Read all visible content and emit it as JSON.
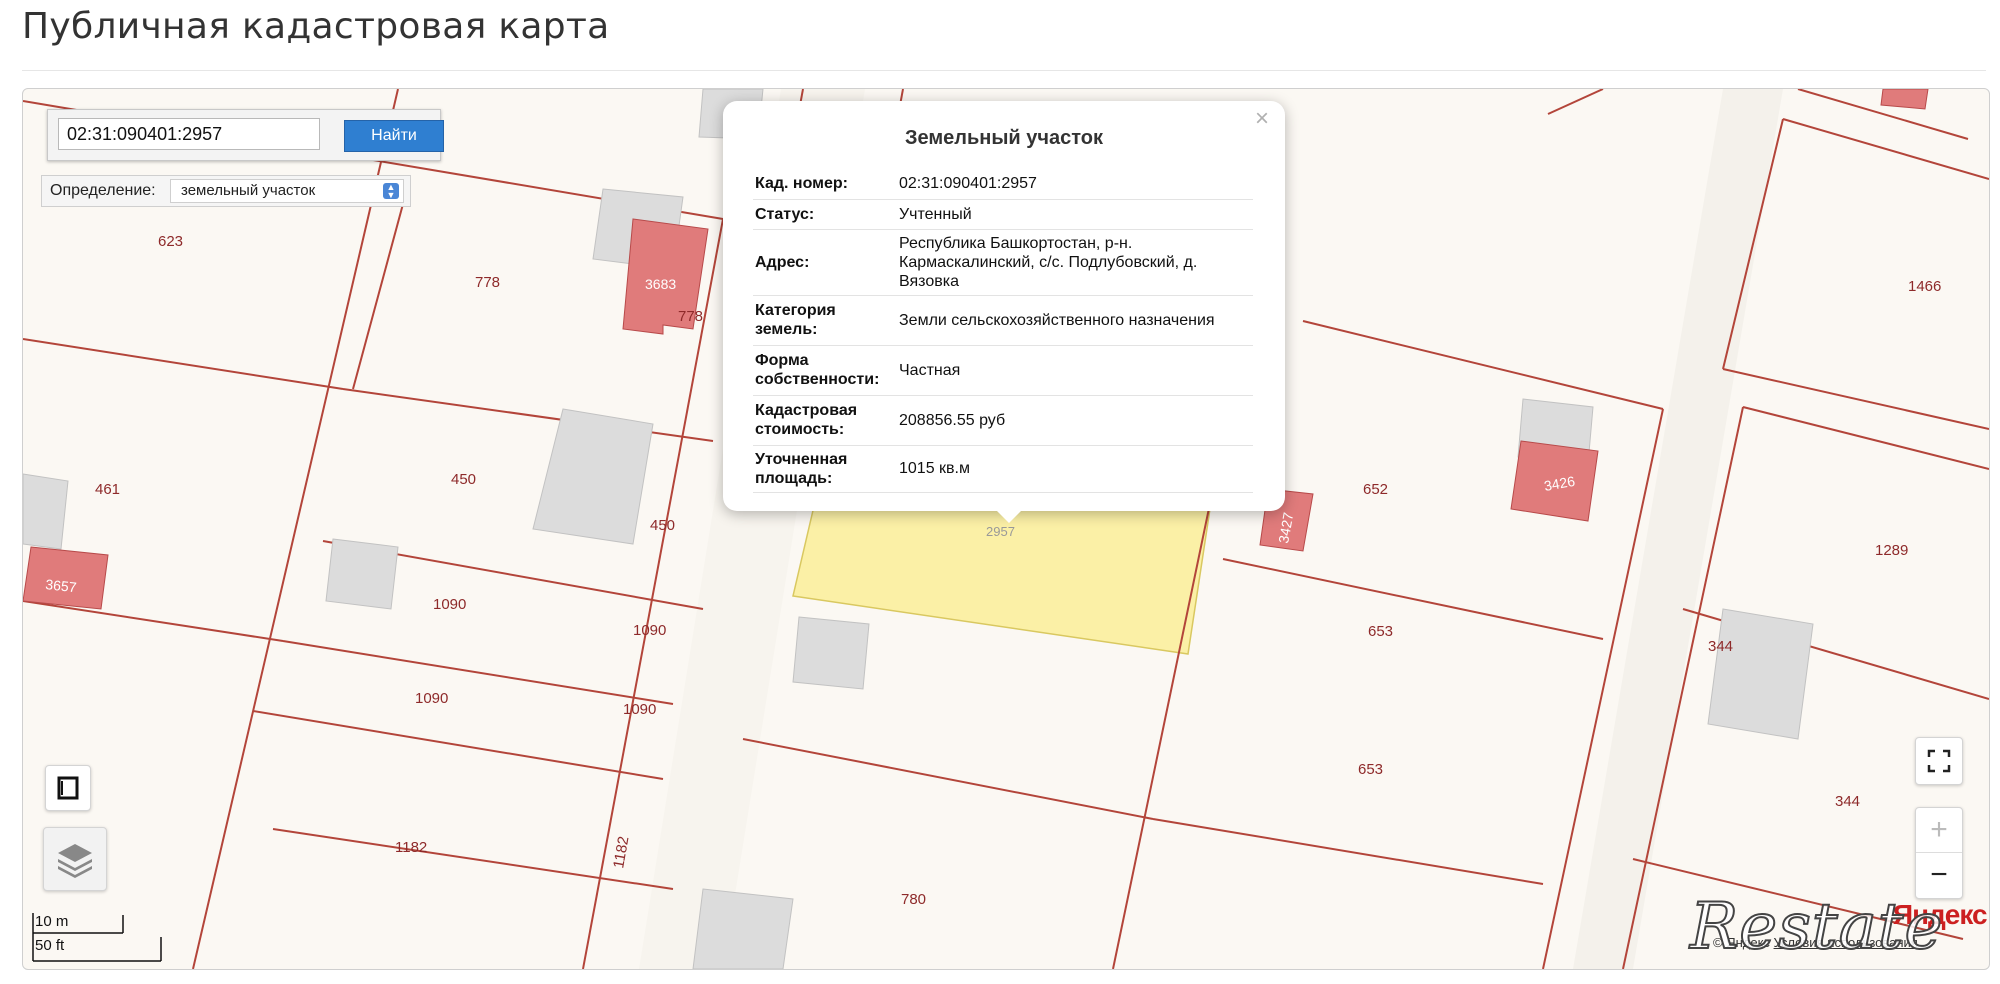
{
  "page": {
    "title": "Публичная кадастровая карта"
  },
  "search": {
    "value": "02:31:090401:2957",
    "button_label": "Найти"
  },
  "definition": {
    "label": "Определение:",
    "selected": "земельный участок"
  },
  "popup": {
    "title": "Земельный участок",
    "close": "×",
    "rows": [
      {
        "key": "Кад. номер:",
        "value": "02:31:090401:2957"
      },
      {
        "key": "Статус:",
        "value": "Учтенный"
      },
      {
        "key": "Адрес:",
        "value": "Республика Башкортостан, р-н. Кармаскалинский, с/с. Подлубовский, д. Вязовка"
      },
      {
        "key": "Категория земель:",
        "value": "Земли сельскохозяйственного назначения"
      },
      {
        "key": "Форма собственности:",
        "value": "Частная"
      },
      {
        "key": "Кадастровая стоимость:",
        "value": "208856.55 руб"
      },
      {
        "key": "Уточненная площадь:",
        "value": "1015 кв.м"
      }
    ]
  },
  "map": {
    "parcel_labels": [
      "623",
      "778",
      "778",
      "1466",
      "461",
      "450",
      "450",
      "652",
      "1289",
      "1090",
      "1090",
      "653",
      "344",
      "1090",
      "1090",
      "653",
      "344",
      "1182",
      "1182",
      "780",
      "2957"
    ],
    "building_labels": [
      "3683",
      "3657",
      "3427",
      "3426"
    ],
    "colors": {
      "boundary": "#b3453a",
      "building_pink": "#e07b7b",
      "building_grey": "#dcdcdc",
      "selected": "#fbf0a6"
    }
  },
  "controls": {
    "fullscreen_icon": "expand-icon",
    "zoom_in": "+",
    "zoom_out": "−",
    "ruler_icon": "ruler-icon",
    "layers_icon": "layers-icon"
  },
  "scale": {
    "metric": "10 m",
    "imperial": "50 ft"
  },
  "attribution": {
    "logo": "Яндекс",
    "text": "© Яндекс",
    "link": "Условия использования"
  },
  "watermark": "Restate"
}
